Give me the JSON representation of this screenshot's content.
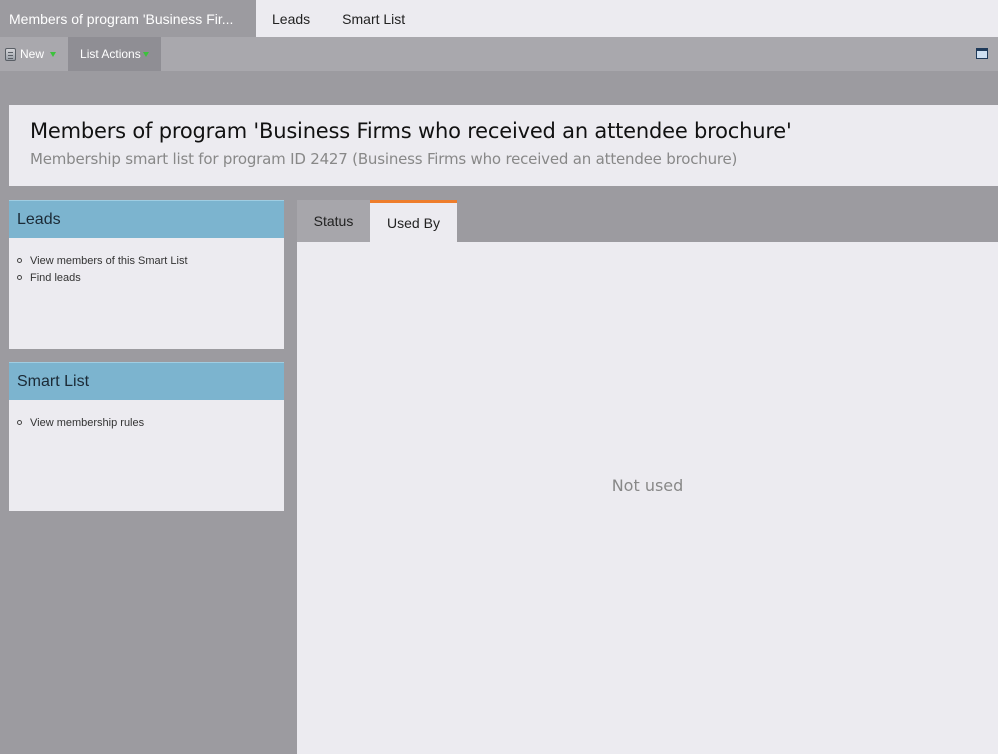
{
  "top_tabs": [
    {
      "label": "Members of program 'Business Fir..."
    },
    {
      "label": "Leads"
    },
    {
      "label": "Smart List"
    }
  ],
  "toolbar": {
    "new_label": "New",
    "list_actions_label": "List Actions"
  },
  "header": {
    "title": "Members of program 'Business Firms who received an attendee brochure'",
    "subtitle": "Membership smart list for program ID 2427 (Business Firms who received an attendee brochure)"
  },
  "leads_panel": {
    "title": "Leads",
    "items": [
      "View members of this Smart List",
      "Find leads"
    ]
  },
  "smartlist_panel": {
    "title": "Smart List",
    "items": [
      "View membership rules"
    ]
  },
  "content": {
    "tabs": [
      "Status",
      "Used By"
    ],
    "active_tab": "Used By",
    "empty_message": "Not used"
  },
  "colors": {
    "accent_tab": "#ee7d2c",
    "panel_header": "#7cb4cf",
    "background": "#9c9ba0"
  }
}
